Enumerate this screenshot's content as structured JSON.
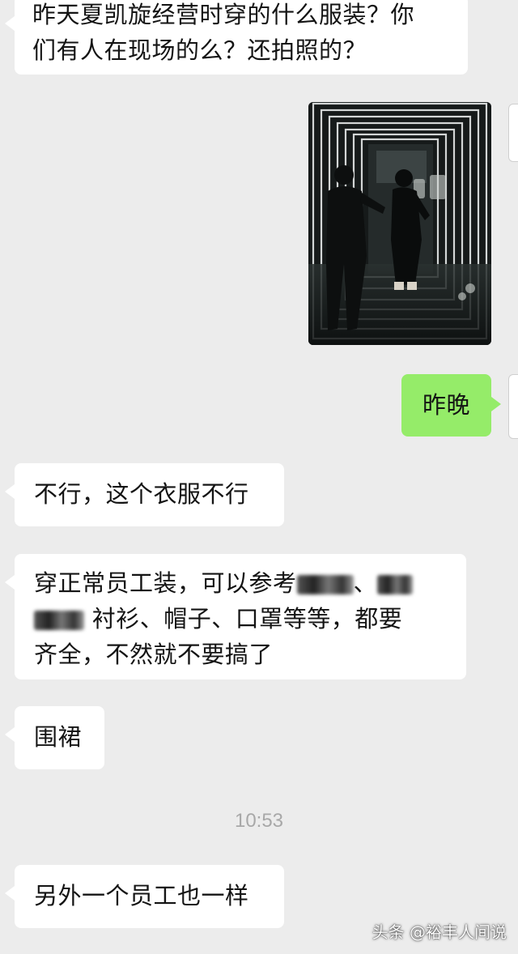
{
  "messages": {
    "m1": {
      "line1": "昨天夏凯旋经营时穿的什么服装？你",
      "line2": "们有人在现场的么？还拍照的？"
    },
    "m2_reply": "昨晚",
    "m3": "不行，这个衣服不行",
    "m4": {
      "line1_a": "穿正常员工装，可以参考",
      "line1_b": "、",
      "line2_a": "衬衫、帽子、口罩等等，都要",
      "line3": "齐全，不然就不要搞了"
    },
    "m5": "围裙",
    "time": "10:53",
    "m6": "另外一个员工也一样"
  },
  "watermark": "头条 @裕丰人间说",
  "colors": {
    "background": "#ececec",
    "incoming_bubble": "#ffffff",
    "outgoing_bubble": "#95ec69",
    "timestamp": "#a8a8a8"
  },
  "icons": {
    "photo": "photo-message"
  }
}
